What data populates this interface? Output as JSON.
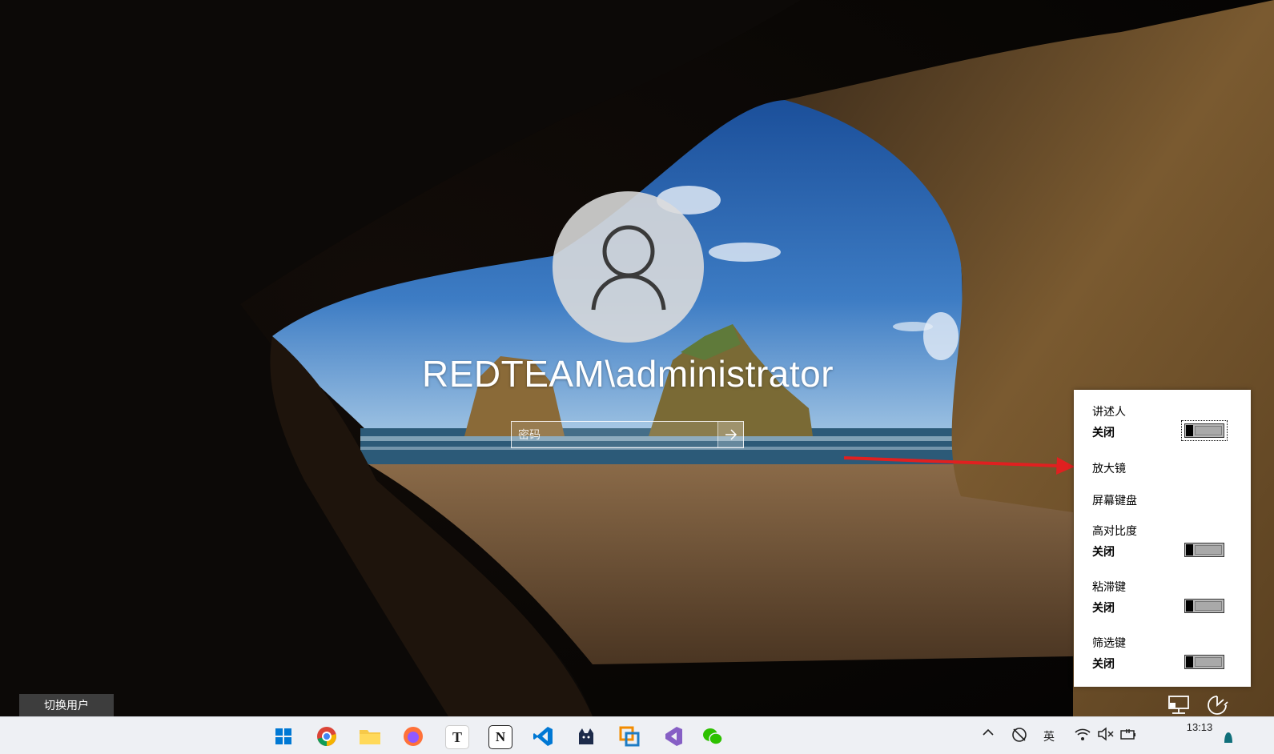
{
  "login": {
    "username": "REDTEAM\\administrator",
    "password_placeholder": "密码"
  },
  "switch_user_label": "切换用户",
  "accessibility": {
    "items": [
      {
        "title": "讲述人",
        "state": "关闭"
      },
      {
        "title": "放大镜"
      },
      {
        "title": "屏幕键盘"
      },
      {
        "title": "高对比度",
        "state": "关闭"
      },
      {
        "title": "粘滞键",
        "state": "关闭"
      },
      {
        "title": "筛选键",
        "state": "关闭"
      }
    ]
  },
  "taskbar": {
    "apps": [
      "start-icon",
      "chrome-icon",
      "file-explorer-icon",
      "firefox-icon",
      "typora-icon",
      "notion-icon",
      "vscode-icon",
      "cat-app-icon",
      "vmware-icon",
      "visual-studio-icon",
      "wechat-icon"
    ],
    "ime_label": "英",
    "time": "13:13"
  },
  "colors": {
    "accent_blue": "#0078d4",
    "arrow_red": "#e02020"
  }
}
